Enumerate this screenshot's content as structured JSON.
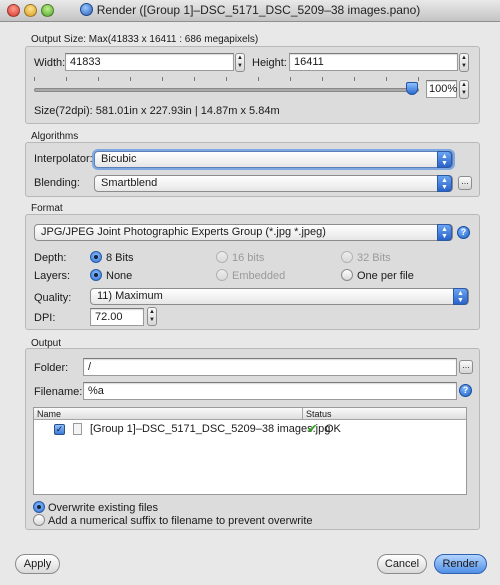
{
  "window": {
    "title": "Render ([Group 1]–DSC_5171_DSC_5209–38 images.pano)"
  },
  "output_size": {
    "label": "Output Size: Max(41833 x 16411 : 686 megapixels)",
    "width_label": "Width:",
    "width_value": "41833",
    "height_label": "Height:",
    "height_value": "16411",
    "scale_value": "100%",
    "scale_fraction": 1.0,
    "size_text": "Size(72dpi): 581.01in x 227.93in | 14.87m x  5.84m"
  },
  "algorithms": {
    "label": "Algorithms",
    "interpolator_label": "Interpolator:",
    "interpolator_value": "Bicubic",
    "blending_label": "Blending:",
    "blending_value": "Smartblend",
    "more_label": "..."
  },
  "format": {
    "label": "Format",
    "type_value": "JPG/JPEG Joint Photographic Experts Group (*.jpg *.jpeg)",
    "depth_label": "Depth:",
    "depth_options": [
      "8 Bits",
      "16 bits",
      "32 Bits"
    ],
    "layers_label": "Layers:",
    "layers_options": [
      "None",
      "Embedded",
      "One per file"
    ],
    "quality_label": "Quality:",
    "quality_value": "11) Maximum",
    "dpi_label": "DPI:",
    "dpi_value": "72.00"
  },
  "output": {
    "label": "Output",
    "folder_label": "Folder:",
    "folder_value": "/",
    "filename_label": "Filename:",
    "filename_value": "%a",
    "more_label": "...",
    "help_label": "?",
    "table": {
      "col_name": "Name",
      "col_status": "Status",
      "rows": [
        {
          "name": "[Group 1]–DSC_5171_DSC_5209–38 images.jpg",
          "status": "OK"
        }
      ]
    },
    "overwrite_label": "Overwrite existing files",
    "suffix_label": "Add a numerical suffix to filename to prevent overwrite"
  },
  "buttons": {
    "apply": "Apply",
    "cancel": "Cancel",
    "render": "Render"
  }
}
